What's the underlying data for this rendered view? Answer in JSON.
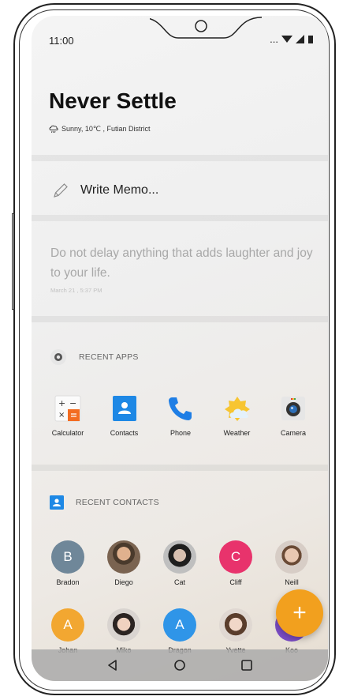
{
  "status_bar": {
    "time": "11:00",
    "dots": "..."
  },
  "header": {
    "title": "Never Settle",
    "weather": "Sunny, 10℃ , Futian District"
  },
  "memo": {
    "label": "Write Memo..."
  },
  "quote": {
    "text": "Do not delay anything that adds laughter and joy to your life.",
    "timestamp": "March 21 , 5:37 PM"
  },
  "recent_apps": {
    "heading": "RECENT APPS",
    "apps": [
      {
        "label": "Calculator",
        "icon": "calculator-icon"
      },
      {
        "label": "Contacts",
        "icon": "contacts-icon"
      },
      {
        "label": "Phone",
        "icon": "phone-icon"
      },
      {
        "label": "Weather",
        "icon": "weather-icon"
      },
      {
        "label": "Camera",
        "icon": "camera-icon"
      }
    ]
  },
  "recent_contacts": {
    "heading": "RECENT CONTACTS",
    "row1": [
      {
        "name": "Bradon",
        "initial": "B",
        "color": "#6f8799"
      },
      {
        "name": "Diego",
        "initial": "",
        "color": "#6b5a48"
      },
      {
        "name": "Cat",
        "initial": "",
        "color": "#3a3a3a"
      },
      {
        "name": "Cliff",
        "initial": "C",
        "color": "#e8336c"
      },
      {
        "name": "Neill",
        "initial": "",
        "color": "#c9b8ab"
      }
    ],
    "row2": [
      {
        "name": "Johan",
        "initial": "A",
        "color": "#f2a731"
      },
      {
        "name": "Miko",
        "initial": "",
        "color": "#2f2a28"
      },
      {
        "name": "Dragon",
        "initial": "A",
        "color": "#2f95e8"
      },
      {
        "name": "Yvette",
        "initial": "",
        "color": "#8a6a55"
      },
      {
        "name": "Koo",
        "initial": "",
        "color": "#7a4cc4"
      }
    ]
  },
  "fab": {
    "label": "+"
  },
  "colors": {
    "accent": "#f2a01e",
    "contacts_blue": "#1e88e5"
  }
}
